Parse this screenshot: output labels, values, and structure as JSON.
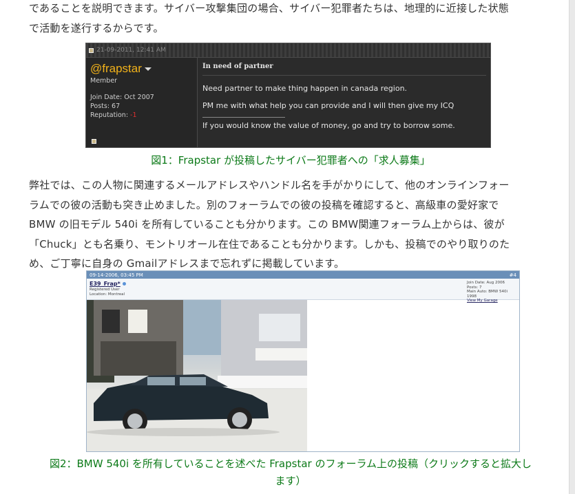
{
  "article": {
    "para1_line1": "であることを説明できます。サイバー攻撃集団の場合、サイバー犯罪者たちは、地理的に近接した状態",
    "para1_line2": "で活動を遂行するからです。",
    "para2_line1": "弊社では、この人物に関連するメールアドレスやハンドル名を手がかりにして、他のオンラインフォー",
    "para2_line2": "ラムでの彼の活動も突き止めました。別のフォーラムでの彼の投稿を確認すると、高級車の愛好家で",
    "para2_line3": "BMW の旧モデル 540i を所有していることも分かります。この BMW関連フォーラム上からは、彼が",
    "para2_line4": "「Chuck」とも名乗り、モントリオール在住であることも分かります。しかも、投稿でのやり取りのた",
    "para2_line5": "め、ご丁寧に自身の Gmailアドレスまで忘れずに掲載しています。",
    "caption1": "図1：Frapstar が投稿したサイバー犯罪者への「求人募集」",
    "caption2_line1": "図2：BMW 540i を所有していることを述べた Frapstar のフォーラム上の投稿（クリックすると拡大し",
    "caption2_line2": "ます）"
  },
  "fig1": {
    "timestamp": "21-09-2011, 12:41 AM",
    "username": "@frapstar",
    "role": "Member",
    "join_date": "Join Date: Oct 2007",
    "posts": "Posts: 67",
    "reputation_label": "Reputation: ",
    "reputation_value": "-1",
    "post_title": "In need of partner",
    "line1": "Need partner to make thing happen in canada region.",
    "line2": "PM me with what help you can provide and I will then give my ICQ",
    "signature": "If you would know the value of money, go and try to borrow some."
  },
  "fig2": {
    "timestamp": "09-14-2006, 03:45 PM",
    "post_number": "#4",
    "username": "E39_Frap*",
    "user_title": "Registered User",
    "location": "Location: Montreal",
    "join_date": "Join Date: Aug 2006",
    "posts": "Posts: 7",
    "main_auto": "Main Auto: BMW 540i 1998",
    "garage_link": "View My Garage"
  },
  "colors": {
    "caption": "#0c7a18",
    "fig1_username": "#f2b21a",
    "fig2_topbar": "#6a8fb8"
  }
}
